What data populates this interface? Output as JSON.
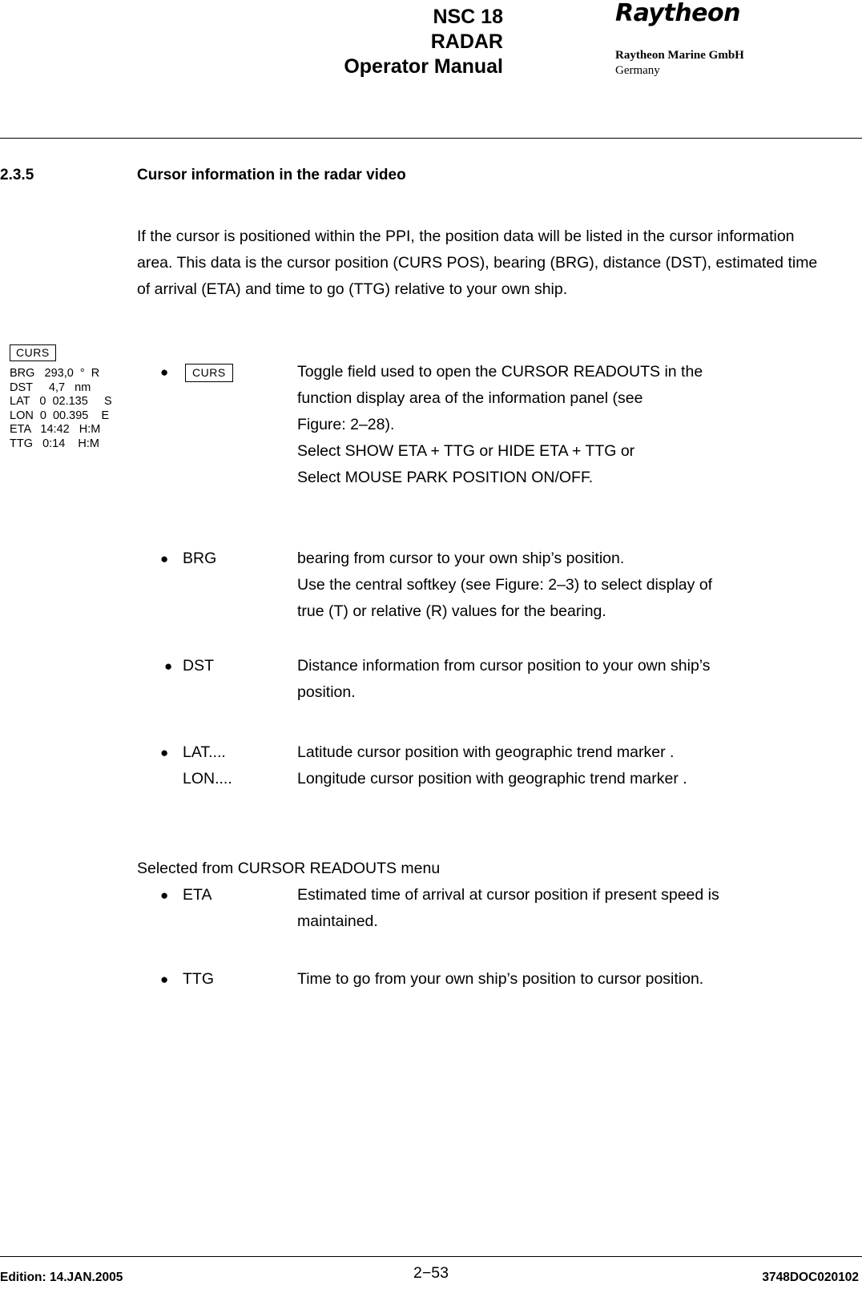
{
  "header": {
    "title_line1": "NSC 18",
    "title_line2": "RADAR",
    "title_line3": "Operator Manual",
    "brand_logo": "Raytheon",
    "brand_company": "Raytheon Marine GmbH",
    "brand_country": "Germany"
  },
  "section": {
    "number": "2.3.5",
    "title": "Cursor information in the radar video",
    "intro": "If the cursor is positioned within the PPI, the position data will be listed in the cursor information area. This data is the cursor position (CURS POS), bearing (BRG), distance (DST), estimated time of arrival (ETA) and time to go (TTG) relative to your own ship."
  },
  "curs_panel": {
    "tab_label": "CURS",
    "readout_lines": "BRG   293,0  °  R\nDST     4,7   nm\nLAT   0  02.135     S\nLON  0  00.395    E\nETA   14:42   H:M\nTTG   0:14    H:M"
  },
  "entries": [
    {
      "bullet": "●",
      "key_label": "CURS",
      "is_key": true,
      "lines": [
        "Toggle field used to open the CURSOR READOUTS in the",
        "function display area of the information panel (see",
        " Figure: 2–28).",
        "Select SHOW ETA + TTG or HIDE ETA + TTG or",
        "Select MOUSE PARK POSITION ON/OFF."
      ]
    },
    {
      "bullet": "●",
      "label": "BRG",
      "is_key": false,
      "lines": [
        "bearing from cursor to your own ship’s position.",
        "Use the central softkey (see Figure: 2–3) to select display of",
        "true (T) or relative (R) values for the bearing."
      ]
    },
    {
      "bullet": "●",
      "label": "DST",
      "is_key": false,
      "lines": [
        "Distance information from cursor position to your own ship’s",
        "position."
      ]
    },
    {
      "bullet": "●",
      "label": "LAT....",
      "label2": "LON....",
      "is_key": false,
      "lines": [
        "Latitude cursor position with geographic trend marker .",
        "Longitude cursor position with geographic trend marker ."
      ]
    }
  ],
  "selected_from": {
    "heading": "Selected from CURSOR READOUTS menu",
    "items": [
      {
        "bullet": "●",
        "label": "ETA",
        "lines": [
          "Estimated time of arrival at cursor position if present speed is",
          "maintained."
        ]
      },
      {
        "bullet": "●",
        "label": "TTG",
        "lines": [
          "Time to go from your own ship’s position to cursor position."
        ]
      }
    ]
  },
  "footer": {
    "edition": "Edition: 14.JAN.2005",
    "page": "2−53",
    "doc_id": "3748DOC020102"
  }
}
